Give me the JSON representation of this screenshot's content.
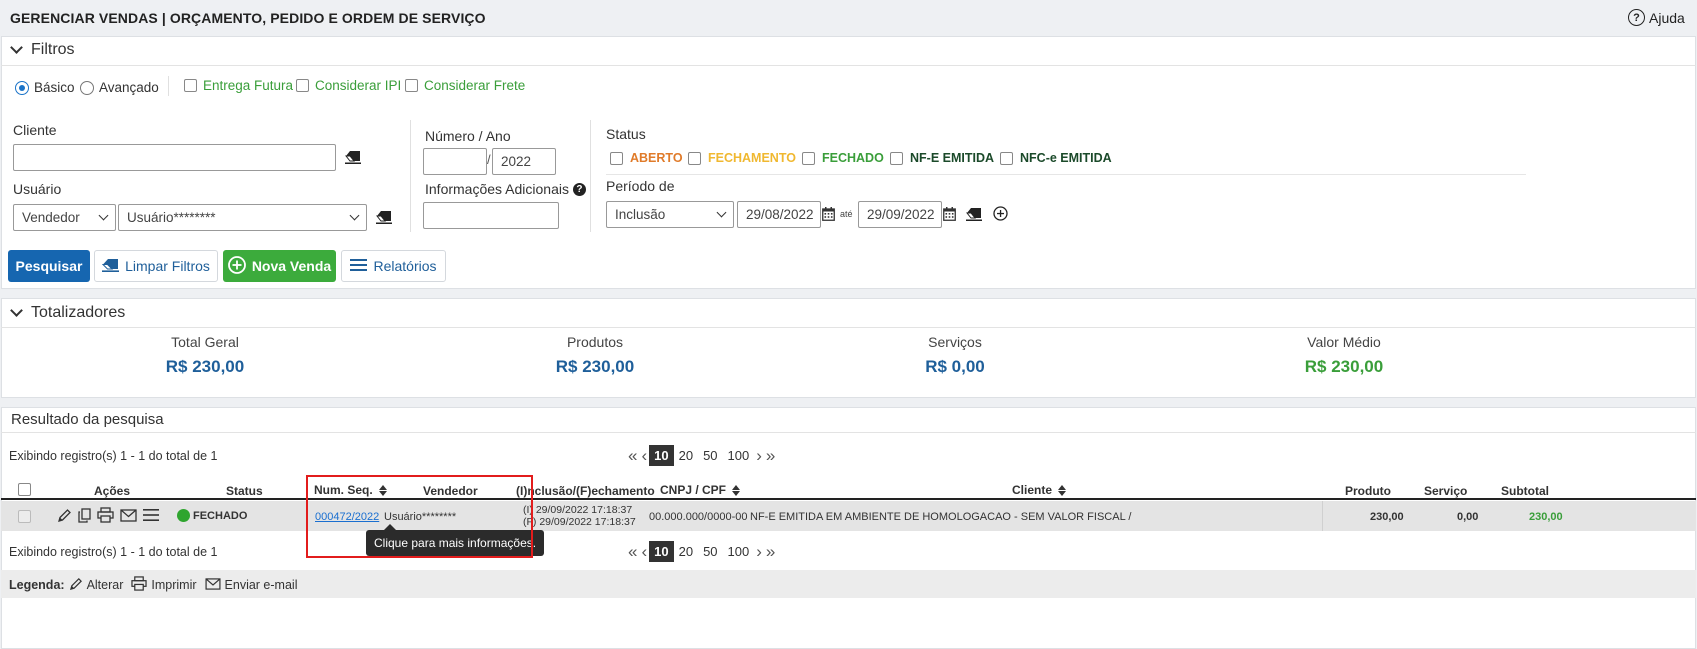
{
  "header": {
    "title": "GERENCIAR VENDAS | ORÇAMENTO, PEDIDO E ORDEM DE SERVIÇO",
    "help_label": "Ajuda"
  },
  "filters": {
    "title": "Filtros",
    "mode_basic": "Básico",
    "mode_advanced": "Avançado",
    "entrega_futura": "Entrega Futura",
    "considerar_ipi": "Considerar IPI",
    "considerar_frete": "Considerar Frete",
    "cliente_label": "Cliente",
    "cliente_value": "",
    "usuario_label": "Usuário",
    "usuario_type": "Vendedor",
    "usuario_value": "Usuário********",
    "numero_ano_label": "Número / Ano",
    "numero_value": "",
    "ano_value": "2022",
    "info_adicionais_label": "Informações Adicionais",
    "info_adicionais_value": "",
    "status_label": "Status",
    "status_options": [
      {
        "label": "ABERTO",
        "color": "#e07b2a"
      },
      {
        "label": "FECHAMENTO",
        "color": "#f0b830"
      },
      {
        "label": "FECHADO",
        "color": "#3a9e3a"
      },
      {
        "label": "NF-E EMITIDA",
        "color": "#1b4a2a"
      },
      {
        "label": "NFC-e EMITIDA",
        "color": "#1b4a2a"
      }
    ],
    "periodo_label": "Período de",
    "periodo_type": "Inclusão",
    "date_from": "29/08/2022",
    "ate": "até",
    "date_to": "29/09/2022"
  },
  "actions": {
    "pesquisar": "Pesquisar",
    "limpar": "Limpar Filtros",
    "nova_venda": "Nova Venda",
    "relatorios": "Relatórios"
  },
  "totalizadores": {
    "title": "Totalizadores",
    "items": [
      {
        "label": "Total Geral",
        "value": "R$ 230,00",
        "color": "#1f5f9a"
      },
      {
        "label": "Produtos",
        "value": "R$ 230,00",
        "color": "#1f5f9a"
      },
      {
        "label": "Serviços",
        "value": "R$ 0,00",
        "color": "#1f5f9a"
      },
      {
        "label": "Valor Médio",
        "value": "R$ 230,00",
        "color": "#3a9e3a"
      }
    ]
  },
  "results": {
    "title": "Resultado da pesquisa",
    "showing": "Exibindo registro(s) 1 - 1 do total de 1",
    "page_sizes": [
      "10",
      "20",
      "50",
      "100"
    ],
    "columns": [
      "Ações",
      "Status",
      "Num. Seq.",
      "Vendedor",
      "(I)nclusão/(F)echamento",
      "CNPJ / CPF",
      "Cliente",
      "Produto",
      "Serviço",
      "Subtotal"
    ],
    "rows": [
      {
        "status": "FECHADO",
        "num_seq": "000472/2022",
        "vendedor": "Usuário********",
        "inclusao": "(I) 29/09/2022 17:18:37",
        "fechamento": "(F) 29/09/2022 17:18:37",
        "cnpj": "00.000.000/0000-00",
        "cliente": "NF-E EMITIDA EM AMBIENTE DE HOMOLOGACAO - SEM VALOR FISCAL /",
        "produto": "230,00",
        "servico": "0,00",
        "subtotal": "230,00",
        "subtotal_color": "#3a9e3a"
      }
    ],
    "tooltip": "Clique para mais informações."
  },
  "legend": {
    "title": "Legenda:",
    "alterar": "Alterar",
    "imprimir": "Imprimir",
    "email": "Enviar e-mail"
  }
}
